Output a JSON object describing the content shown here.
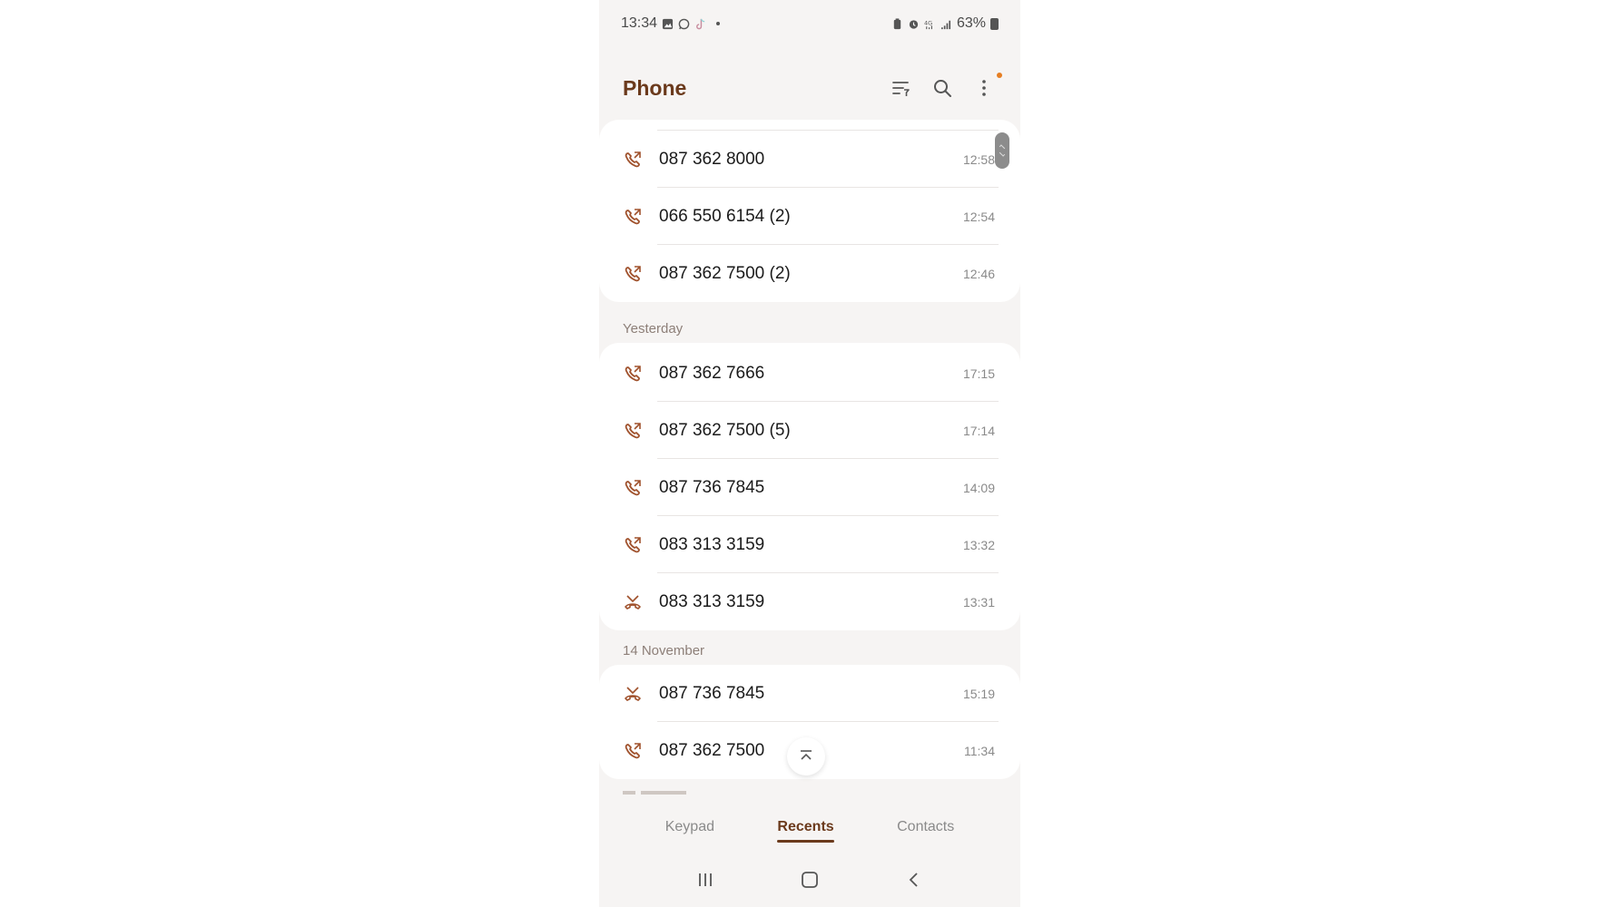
{
  "status_bar": {
    "time": "13:34",
    "battery": "63%"
  },
  "header": {
    "title": "Phone"
  },
  "calls_today": [
    {
      "number": "087 362 8000",
      "time": "12:58",
      "type": "outgoing"
    },
    {
      "number": "066 550 6154 (2)",
      "time": "12:54",
      "type": "outgoing"
    },
    {
      "number": "087 362 7500 (2)",
      "time": "12:46",
      "type": "outgoing"
    }
  ],
  "section_yesterday": "Yesterday",
  "calls_yesterday": [
    {
      "number": "087 362 7666",
      "time": "17:15",
      "type": "outgoing"
    },
    {
      "number": "087 362 7500 (5)",
      "time": "17:14",
      "type": "outgoing"
    },
    {
      "number": "087 736 7845",
      "time": "14:09",
      "type": "outgoing"
    },
    {
      "number": "083 313 3159",
      "time": "13:32",
      "type": "outgoing"
    },
    {
      "number": "083 313 3159",
      "time": "13:31",
      "type": "missed"
    }
  ],
  "section_nov14": "14 November",
  "calls_nov14": [
    {
      "number": "087 736 7845",
      "time": "15:19",
      "type": "missed"
    },
    {
      "number": "087 362 7500",
      "time": "11:34",
      "type": "outgoing"
    }
  ],
  "tabs": {
    "keypad": "Keypad",
    "recents": "Recents",
    "contacts": "Contacts"
  },
  "colors": {
    "accent": "#6b3a1c",
    "icon": "#a0522d",
    "background": "#f6f4f3",
    "notification": "#e67e22"
  }
}
